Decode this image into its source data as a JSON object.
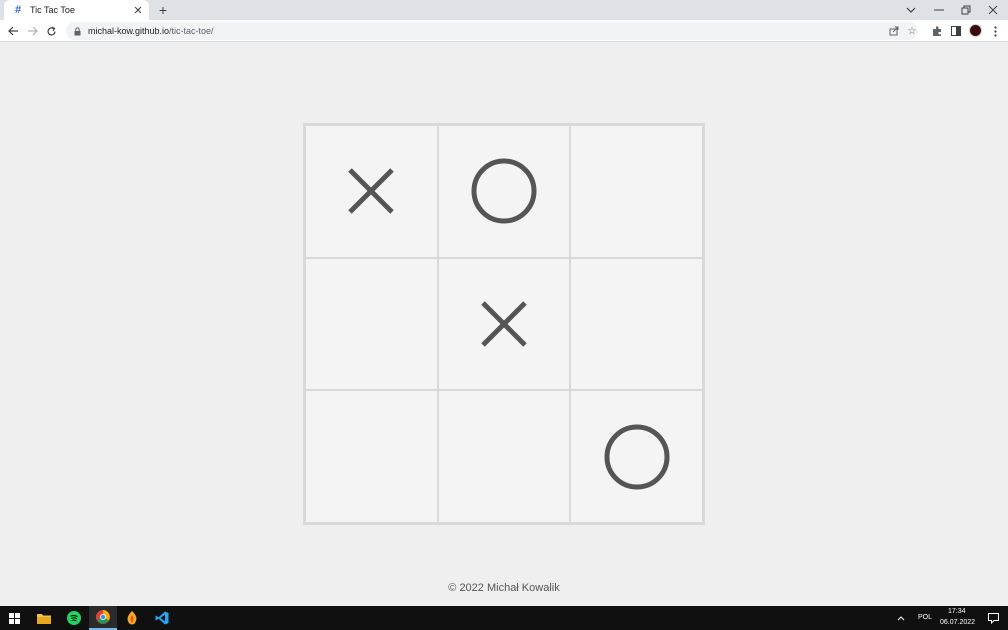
{
  "browser": {
    "tab_title": "Tic Tac Toe",
    "tab_favicon": "#",
    "url_host": "michal-kow.github.io",
    "url_path": "/tic-tac-toe/"
  },
  "board": {
    "cells": [
      "X",
      "O",
      "",
      "",
      "X",
      "",
      "",
      "",
      "O"
    ],
    "mark_color": "#555555"
  },
  "footer": {
    "text": "© 2022 Michał Kowalik"
  },
  "taskbar": {
    "language": "POL",
    "time": "17:34",
    "date": "06.07.2022"
  },
  "colors": {
    "page_background": "#efefef",
    "cell_background": "#f4f4f4",
    "grid_lines": "#d9d9d9"
  }
}
